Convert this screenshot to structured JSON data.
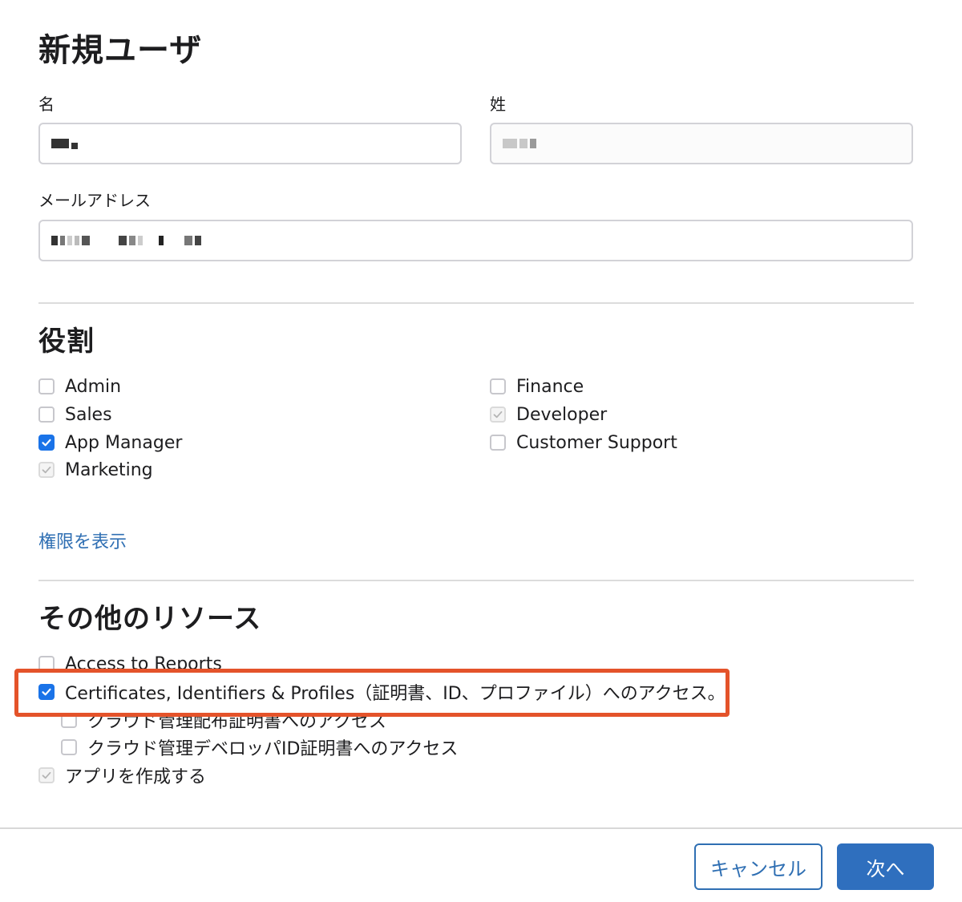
{
  "title": "新規ユーザ",
  "fields": {
    "first_name_label": "名",
    "last_name_label": "姓",
    "email_label": "メールアドレス"
  },
  "roles": {
    "title": "役割",
    "left": [
      {
        "label": "Admin",
        "state": "unchecked"
      },
      {
        "label": "Sales",
        "state": "unchecked"
      },
      {
        "label": "App Manager",
        "state": "checked"
      },
      {
        "label": "Marketing",
        "state": "disabled-checked"
      }
    ],
    "right": [
      {
        "label": "Finance",
        "state": "unchecked"
      },
      {
        "label": "Developer",
        "state": "disabled-checked"
      },
      {
        "label": "Customer Support",
        "state": "unchecked"
      }
    ],
    "permissions_link": "権限を表示"
  },
  "resources": {
    "title": "その他のリソース",
    "items": [
      {
        "label": "Access to Reports",
        "state": "unchecked"
      },
      {
        "label": "Certificates, Identifiers & Profiles（証明書、ID、プロファイル）へのアクセス。",
        "state": "checked"
      },
      {
        "label": "クラウド管理配布証明書へのアクセス",
        "state": "unchecked"
      },
      {
        "label": "クラウド管理デベロッパID証明書へのアクセス",
        "state": "unchecked"
      },
      {
        "label": "アプリを作成する",
        "state": "disabled-checked"
      }
    ]
  },
  "footer": {
    "cancel_label": "キャンセル",
    "next_label": "次へ"
  },
  "colors": {
    "accent": "#2f6fb3",
    "checkbox_checked": "#1a73e8",
    "highlight": "#e4532a"
  }
}
